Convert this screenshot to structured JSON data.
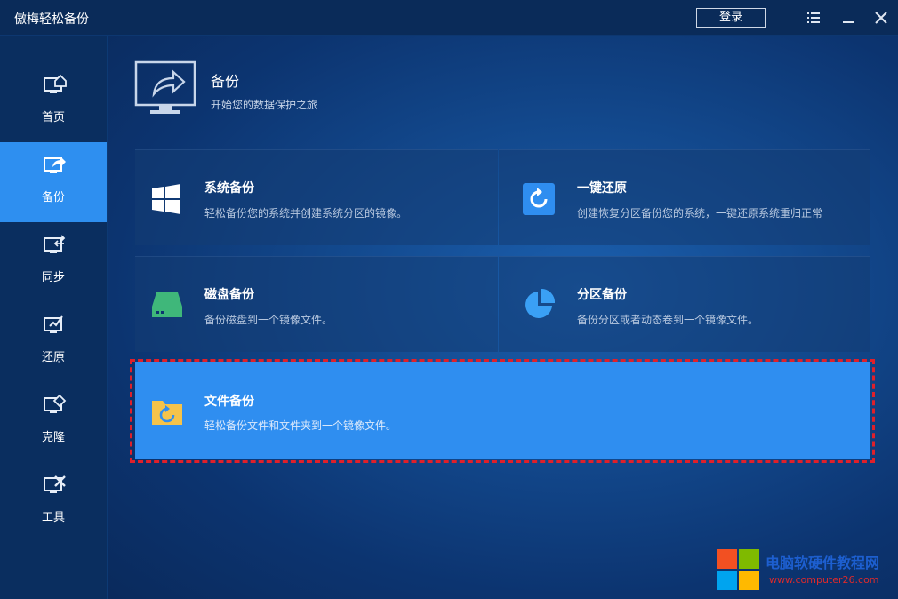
{
  "app": {
    "title": "傲梅轻松备份",
    "login_label": "登录"
  },
  "sidebar": {
    "items": [
      {
        "label": "首页",
        "icon": "home-monitor-icon",
        "active": false
      },
      {
        "label": "备份",
        "icon": "backup-monitor-icon",
        "active": true
      },
      {
        "label": "同步",
        "icon": "sync-monitor-icon",
        "active": false
      },
      {
        "label": "还原",
        "icon": "restore-monitor-icon",
        "active": false
      },
      {
        "label": "克隆",
        "icon": "clone-monitor-icon",
        "active": false
      },
      {
        "label": "工具",
        "icon": "tools-monitor-icon",
        "active": false
      }
    ]
  },
  "header": {
    "title": "备份",
    "subtitle": "开始您的数据保护之旅"
  },
  "cards": [
    {
      "title": "系统备份",
      "desc": "轻松备份您的系统并创建系统分区的镜像。",
      "icon": "windows-icon"
    },
    {
      "title": "一键还原",
      "desc": "创建恢复分区备份您的系统，一键还原系统重归正常",
      "icon": "restore-circle-icon"
    },
    {
      "title": "磁盘备份",
      "desc": "备份磁盘到一个镜像文件。",
      "icon": "disk-icon"
    },
    {
      "title": "分区备份",
      "desc": "备份分区或者动态卷到一个镜像文件。",
      "icon": "pie-icon"
    },
    {
      "title": "文件备份",
      "desc": "轻松备份文件和文件夹到一个镜像文件。",
      "icon": "folder-refresh-icon"
    }
  ],
  "watermark": {
    "text": "电脑软硬件教程网",
    "url": "www.computer26.com"
  },
  "colors": {
    "accent": "#2f8ef0",
    "highlight_border": "#e0202a",
    "background": "#0b2a55"
  }
}
